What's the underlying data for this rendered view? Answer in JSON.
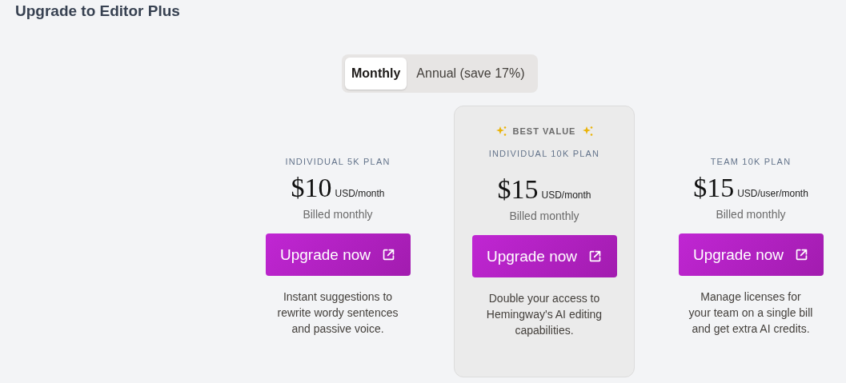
{
  "page": {
    "title": "Upgrade to Editor Plus"
  },
  "billing_toggle": [
    {
      "label": "Monthly",
      "selected": true
    },
    {
      "label": "Annual (save 17%)",
      "selected": false
    }
  ],
  "plans": [
    {
      "name": "INDIVIDUAL 5K PLAN",
      "featured": false,
      "price": "$10",
      "unit": "USD/month",
      "billing": "Billed monthly",
      "button": "Upgrade now",
      "description": "Instant suggestions to rewrite wordy sentences and passive voice."
    },
    {
      "name": "INDIVIDUAL 10K PLAN",
      "featured": true,
      "badge": "BEST VALUE",
      "price": "$15",
      "unit": "USD/month",
      "billing": "Billed monthly",
      "button": "Upgrade now",
      "description": "Double your access to Hemingway's AI editing capabilities."
    },
    {
      "name": "TEAM 10K PLAN",
      "featured": false,
      "price": "$15",
      "unit": "USD/user/month",
      "billing": "Billed monthly",
      "button": "Upgrade now",
      "description": "Manage licenses for your team on a single bill and get extra AI credits."
    }
  ]
}
